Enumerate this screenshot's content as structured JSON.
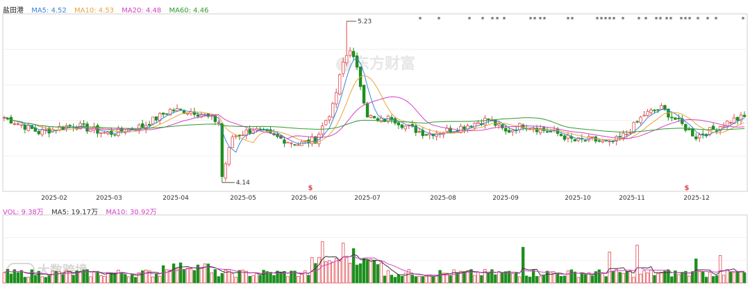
{
  "chart_data": [
    {
      "type": "candlestick",
      "name_label": "盐田港",
      "legend": [
        {
          "label": "MA5: 4.52",
          "color": "#3b82d6"
        },
        {
          "label": "MA10: 4.53",
          "color": "#e8a33a"
        },
        {
          "label": "MA20: 4.48",
          "color": "#d53fc9"
        },
        {
          "label": "MA60: 4.46",
          "color": "#2f9a2f"
        }
      ],
      "ylim": [
        4.08,
        5.28
      ],
      "x_tick_labels": [
        "2025-02",
        "2025-03",
        "2025-04",
        "2025-05",
        "2025-06",
        "2025-07",
        "2025-08",
        "2025-09",
        "2025-10",
        "2025-11",
        "2025-12"
      ],
      "annotations": [
        {
          "text": "5.23",
          "value": 5.23,
          "kind": "high"
        },
        {
          "text": "4.14",
          "value": 4.14,
          "kind": "low"
        }
      ],
      "dividend_marker": "$",
      "star_marker": "*",
      "series": {
        "ma5_color": "#3b82d6",
        "ma10_color": "#e8a33a",
        "ma20_color": "#d53fc9",
        "ma60_color": "#2f9a2f",
        "up_color": "#e0474c",
        "down_color": "#1f8f1f"
      }
    },
    {
      "type": "bar",
      "legend": [
        {
          "label": "VOL: 9.38万",
          "color": "#d53fc9"
        },
        {
          "label": "MA5: 19.17万",
          "color": "#333333"
        },
        {
          "label": "MA10: 30.92万",
          "color": "#d53fc9"
        }
      ]
    }
  ],
  "watermark_brand": "东方财富",
  "watermark_corner": "大数跨境"
}
